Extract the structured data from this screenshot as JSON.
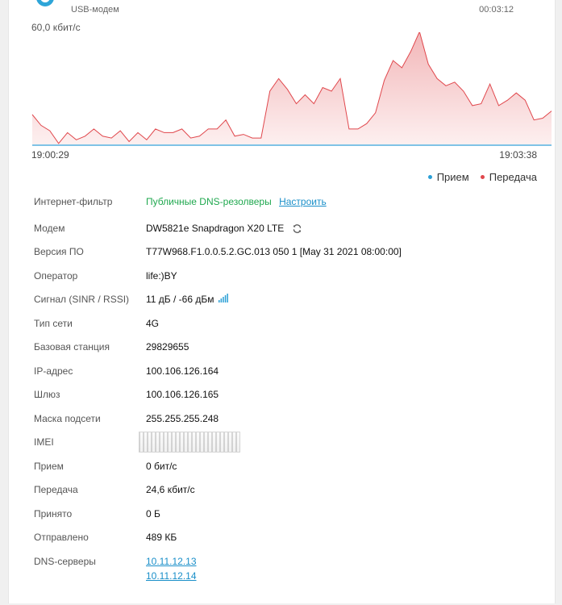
{
  "header": {
    "modem_type": "USB-модем",
    "uptime": "00:03:12"
  },
  "chart": {
    "rate_max": "60,0 кбит/с",
    "time_start": "19:00:29",
    "time_end": "19:03:38",
    "legend": [
      {
        "label": "Прием",
        "color": "#2a9fd6"
      },
      {
        "label": "Передача",
        "color": "#e0474c"
      }
    ]
  },
  "chart_data": {
    "type": "area",
    "title": "",
    "ylim": [
      0,
      60
    ],
    "x_labels": [
      "19:00:29",
      "19:03:38"
    ],
    "series": [
      {
        "name": "Передача",
        "color": "#e0474c",
        "values": [
          17,
          11,
          8,
          1,
          7,
          3,
          5,
          9,
          5,
          4,
          8,
          2,
          7,
          3,
          9,
          7,
          7,
          9,
          4,
          5,
          9,
          9,
          14,
          5,
          6,
          4,
          4,
          30,
          37,
          31,
          23,
          28,
          23,
          32,
          30,
          37,
          9,
          9,
          12,
          18,
          36,
          47,
          43,
          52,
          63,
          45,
          37,
          33,
          35,
          30,
          22,
          23,
          34,
          22,
          25,
          29,
          25,
          14,
          15,
          19
        ],
        "unit": "кбит/с"
      },
      {
        "name": "Прием",
        "color": "#2a9fd6",
        "values": [
          0,
          0,
          0,
          0,
          0,
          0,
          0,
          0,
          0,
          0,
          0,
          0,
          0,
          0,
          0,
          0,
          0,
          0,
          0,
          0,
          0,
          0,
          0,
          0,
          0,
          0,
          0,
          0,
          0,
          0,
          0,
          0,
          0,
          0,
          0,
          0,
          0,
          0,
          0,
          0,
          0,
          0,
          0,
          0,
          0,
          0,
          0,
          0,
          0,
          0,
          0,
          0,
          0,
          0,
          0,
          0,
          0,
          0,
          0,
          0
        ],
        "unit": "кбит/с"
      }
    ]
  },
  "info": {
    "filter": {
      "label": "Интернет-фильтр",
      "value": "Публичные DNS-резолверы",
      "link": "Настроить"
    },
    "modem": {
      "label": "Модем",
      "value": "DW5821e Snapdragon X20 LTE"
    },
    "firmware": {
      "label": "Версия ПО",
      "value": "T77W968.F1.0.0.5.2.GC.013 050 1 [May 31 2021 08:00:00]"
    },
    "operator": {
      "label": "Оператор",
      "value": "life:)BY"
    },
    "signal": {
      "label": "Сигнал (SINR / RSSI)",
      "value": "11 дБ / -66 дБм"
    },
    "network_type": {
      "label": "Тип сети",
      "value": "4G"
    },
    "base_station": {
      "label": "Базовая станция",
      "value": "29829655"
    },
    "ip": {
      "label": "IP-адрес",
      "value": "100.106.126.164"
    },
    "gateway": {
      "label": "Шлюз",
      "value": "100.106.126.165"
    },
    "mask": {
      "label": "Маска подсети",
      "value": "255.255.255.248"
    },
    "imei": {
      "label": "IMEI"
    },
    "rx_rate": {
      "label": "Прием",
      "value": "0 бит/с"
    },
    "tx_rate": {
      "label": "Передача",
      "value": "24,6 кбит/с"
    },
    "received": {
      "label": "Принято",
      "value": "0 Б"
    },
    "sent": {
      "label": "Отправлено",
      "value": "489 КБ"
    },
    "dns": {
      "label": "DNS-серверы",
      "servers": [
        "10.11.12.13",
        "10.11.12.14"
      ]
    }
  },
  "icons": {
    "status": "status-circle-icon",
    "sync": "sync-icon",
    "signal": "signal-bars-icon"
  }
}
